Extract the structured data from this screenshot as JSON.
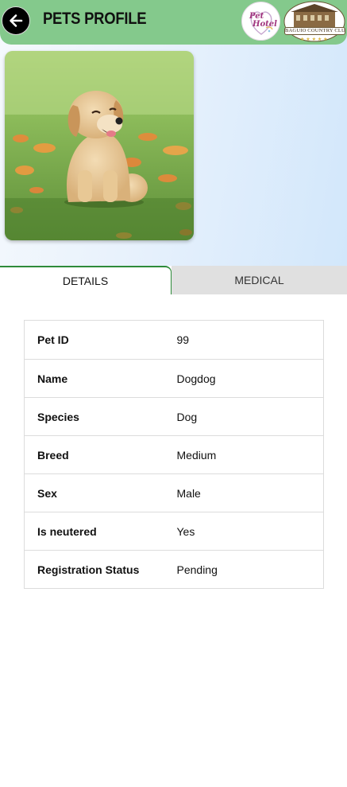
{
  "header": {
    "title": "PETS PROFILE",
    "back_icon": "arrow-left-icon",
    "logo_pet_text_line1": "Pet",
    "logo_pet_text_line2": "Hotel",
    "logo_club_text": "BAGUIO COUNTRY CLUB"
  },
  "tabs": [
    {
      "label": "DETAILS",
      "active": true
    },
    {
      "label": "MEDICAL",
      "active": false
    }
  ],
  "details": [
    {
      "key": "Pet ID",
      "value": "99"
    },
    {
      "key": "Name",
      "value": "Dogdog"
    },
    {
      "key": "Species",
      "value": "Dog"
    },
    {
      "key": "Breed",
      "value": "Medium"
    },
    {
      "key": "Sex",
      "value": "Male"
    },
    {
      "key": "Is neutered",
      "value": "Yes"
    },
    {
      "key": "Registration Status",
      "value": "Pending"
    }
  ],
  "colors": {
    "header": "#84c98c",
    "active_tab_border": "#2e8b3a",
    "inactive_tab": "#e0e0e0"
  }
}
